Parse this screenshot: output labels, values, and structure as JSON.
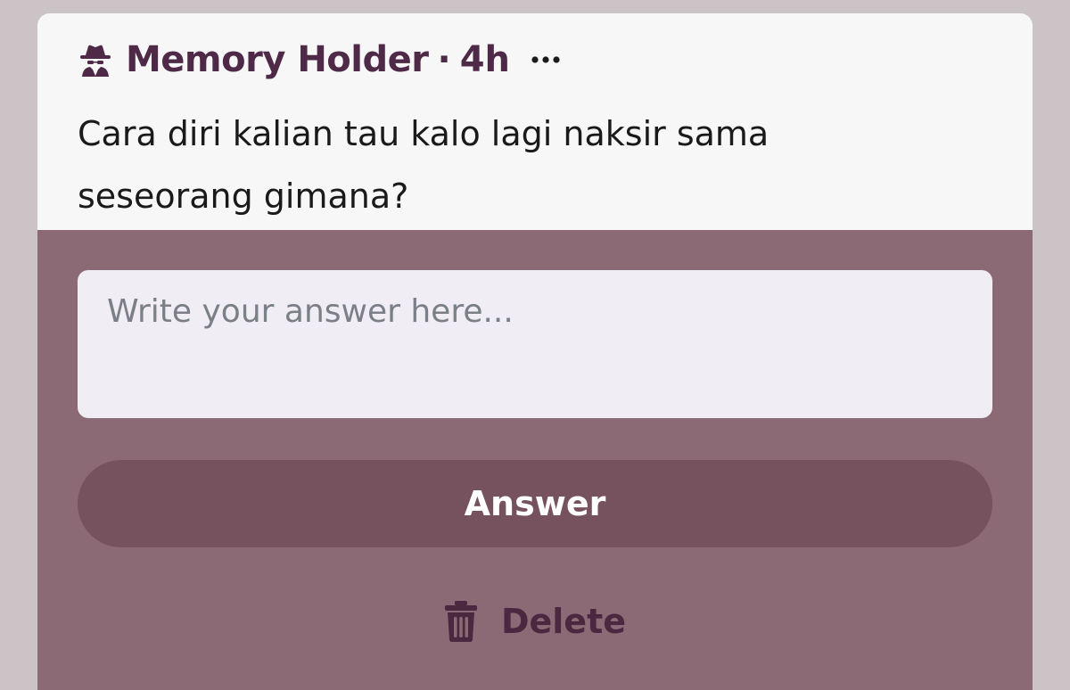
{
  "post": {
    "author": "Memory Holder",
    "separator": "·",
    "timestamp": "4h",
    "author_icon": "spy-icon",
    "more_icon": "more-horizontal-icon",
    "question": "Cara diri kalian tau kalo lagi naksir sama seseorang gimana?"
  },
  "answer_form": {
    "placeholder": "Write your answer here...",
    "value": "",
    "submit_label": "Answer",
    "delete_label": "Delete",
    "delete_icon": "trash-icon"
  },
  "colors": {
    "page_background": "#cbc3c6",
    "card_header": "#f7f7f7",
    "card_body": "#8b6a75",
    "accent_text": "#4f2a48",
    "answer_button": "#76525f",
    "input_background": "#f0edf4"
  }
}
